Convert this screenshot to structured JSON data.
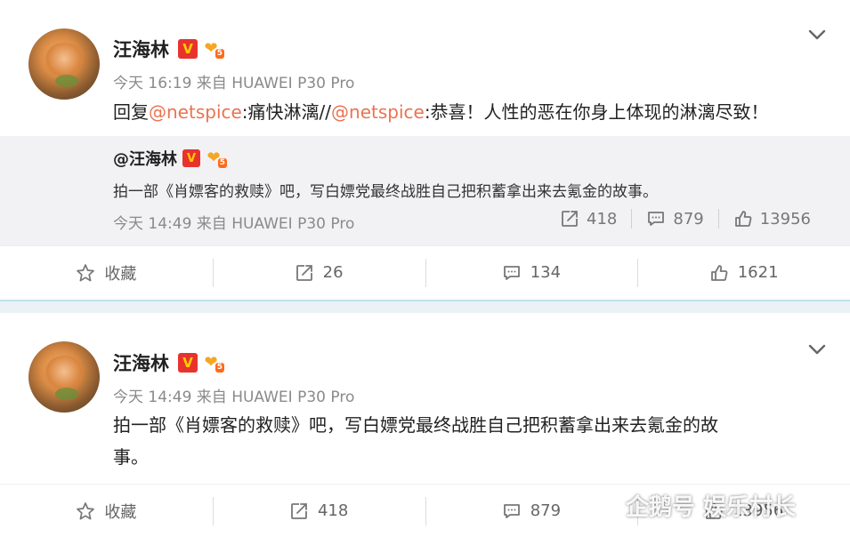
{
  "post1": {
    "author": "汪海林",
    "verified_badge": "V",
    "fan_badge_level": "5",
    "meta": "今天 16:19 来自 HUAWEI P30 Pro",
    "text": {
      "prefix": "回复",
      "mention1": "@netspice",
      "part1": ":痛快淋漓//",
      "mention2": "@netspice",
      "part2": ":恭喜！人性的恶在你身上体现的淋漓尽致！"
    },
    "repost": {
      "author": "@汪海林",
      "verified_badge": "V",
      "fan_badge_level": "5",
      "text": "拍一部《肖嫖客的救赎》吧，写白嫖党最终战胜自己把积蓄拿出来去氪金的故事。",
      "meta": "今天 14:49 来自 HUAWEI P30 Pro",
      "reposts": "418",
      "comments": "879",
      "likes": "13956"
    },
    "actions": {
      "favorite": "收藏",
      "reposts": "26",
      "comments": "134",
      "likes": "1621"
    }
  },
  "post2": {
    "author": "汪海林",
    "verified_badge": "V",
    "fan_badge_level": "5",
    "meta": "今天 14:49 来自 HUAWEI P30 Pro",
    "text_line1": "拍一部《肖嫖客的救赎》吧，写白嫖党最终战胜自己把积蓄拿出来去氪金的故",
    "text_line2": "事。",
    "actions": {
      "favorite": "收藏",
      "reposts": "418",
      "comments": "879",
      "likes": "13956"
    }
  },
  "watermark": "企鹅号 娱乐村长",
  "icons": [
    "chevron-down-icon",
    "star-icon",
    "repost-icon",
    "comment-icon",
    "like-icon",
    "penguin-logo-icon"
  ],
  "colors": {
    "mention": "#eb7350",
    "verified": "#e8332d",
    "repost_bg": "#f2f2f5",
    "divider_band": "#eaf2f6"
  }
}
